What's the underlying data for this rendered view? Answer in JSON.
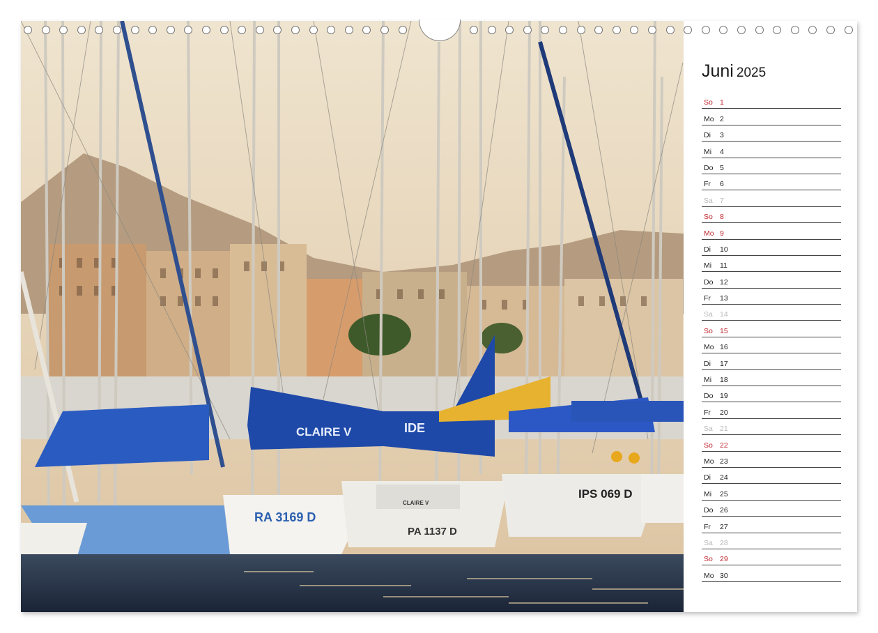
{
  "calendar": {
    "month": "Juni",
    "year": "2025",
    "days": [
      {
        "wd": "So",
        "d": "1",
        "type": "sun"
      },
      {
        "wd": "Mo",
        "d": "2",
        "type": "work"
      },
      {
        "wd": "Di",
        "d": "3",
        "type": "work"
      },
      {
        "wd": "Mi",
        "d": "4",
        "type": "work"
      },
      {
        "wd": "Do",
        "d": "5",
        "type": "work"
      },
      {
        "wd": "Fr",
        "d": "6",
        "type": "work"
      },
      {
        "wd": "Sa",
        "d": "7",
        "type": "sat"
      },
      {
        "wd": "So",
        "d": "8",
        "type": "sun"
      },
      {
        "wd": "Mo",
        "d": "9",
        "type": "sun"
      },
      {
        "wd": "Di",
        "d": "10",
        "type": "work"
      },
      {
        "wd": "Mi",
        "d": "11",
        "type": "work"
      },
      {
        "wd": "Do",
        "d": "12",
        "type": "work"
      },
      {
        "wd": "Fr",
        "d": "13",
        "type": "work"
      },
      {
        "wd": "Sa",
        "d": "14",
        "type": "sat"
      },
      {
        "wd": "So",
        "d": "15",
        "type": "sun"
      },
      {
        "wd": "Mo",
        "d": "16",
        "type": "work"
      },
      {
        "wd": "Di",
        "d": "17",
        "type": "work"
      },
      {
        "wd": "Mi",
        "d": "18",
        "type": "work"
      },
      {
        "wd": "Do",
        "d": "19",
        "type": "work"
      },
      {
        "wd": "Fr",
        "d": "20",
        "type": "work"
      },
      {
        "wd": "Sa",
        "d": "21",
        "type": "sat"
      },
      {
        "wd": "So",
        "d": "22",
        "type": "sun"
      },
      {
        "wd": "Mo",
        "d": "23",
        "type": "work"
      },
      {
        "wd": "Di",
        "d": "24",
        "type": "work"
      },
      {
        "wd": "Mi",
        "d": "25",
        "type": "work"
      },
      {
        "wd": "Do",
        "d": "26",
        "type": "work"
      },
      {
        "wd": "Fr",
        "d": "27",
        "type": "work"
      },
      {
        "wd": "Sa",
        "d": "28",
        "type": "sat"
      },
      {
        "wd": "So",
        "d": "29",
        "type": "sun"
      },
      {
        "wd": "Mo",
        "d": "30",
        "type": "work"
      }
    ]
  },
  "photo": {
    "boat_names": [
      "CLAIRE V",
      "RA 3169 D",
      "PA 1137 D",
      "IPS 069 D",
      "CLAIRE V",
      "IDE"
    ]
  },
  "colors": {
    "sunday": "#c0282f",
    "saturday": "#b9b9b9",
    "sky": "#e9d7bd",
    "water": "#20304a",
    "sail_blue": "#1f49a8"
  }
}
